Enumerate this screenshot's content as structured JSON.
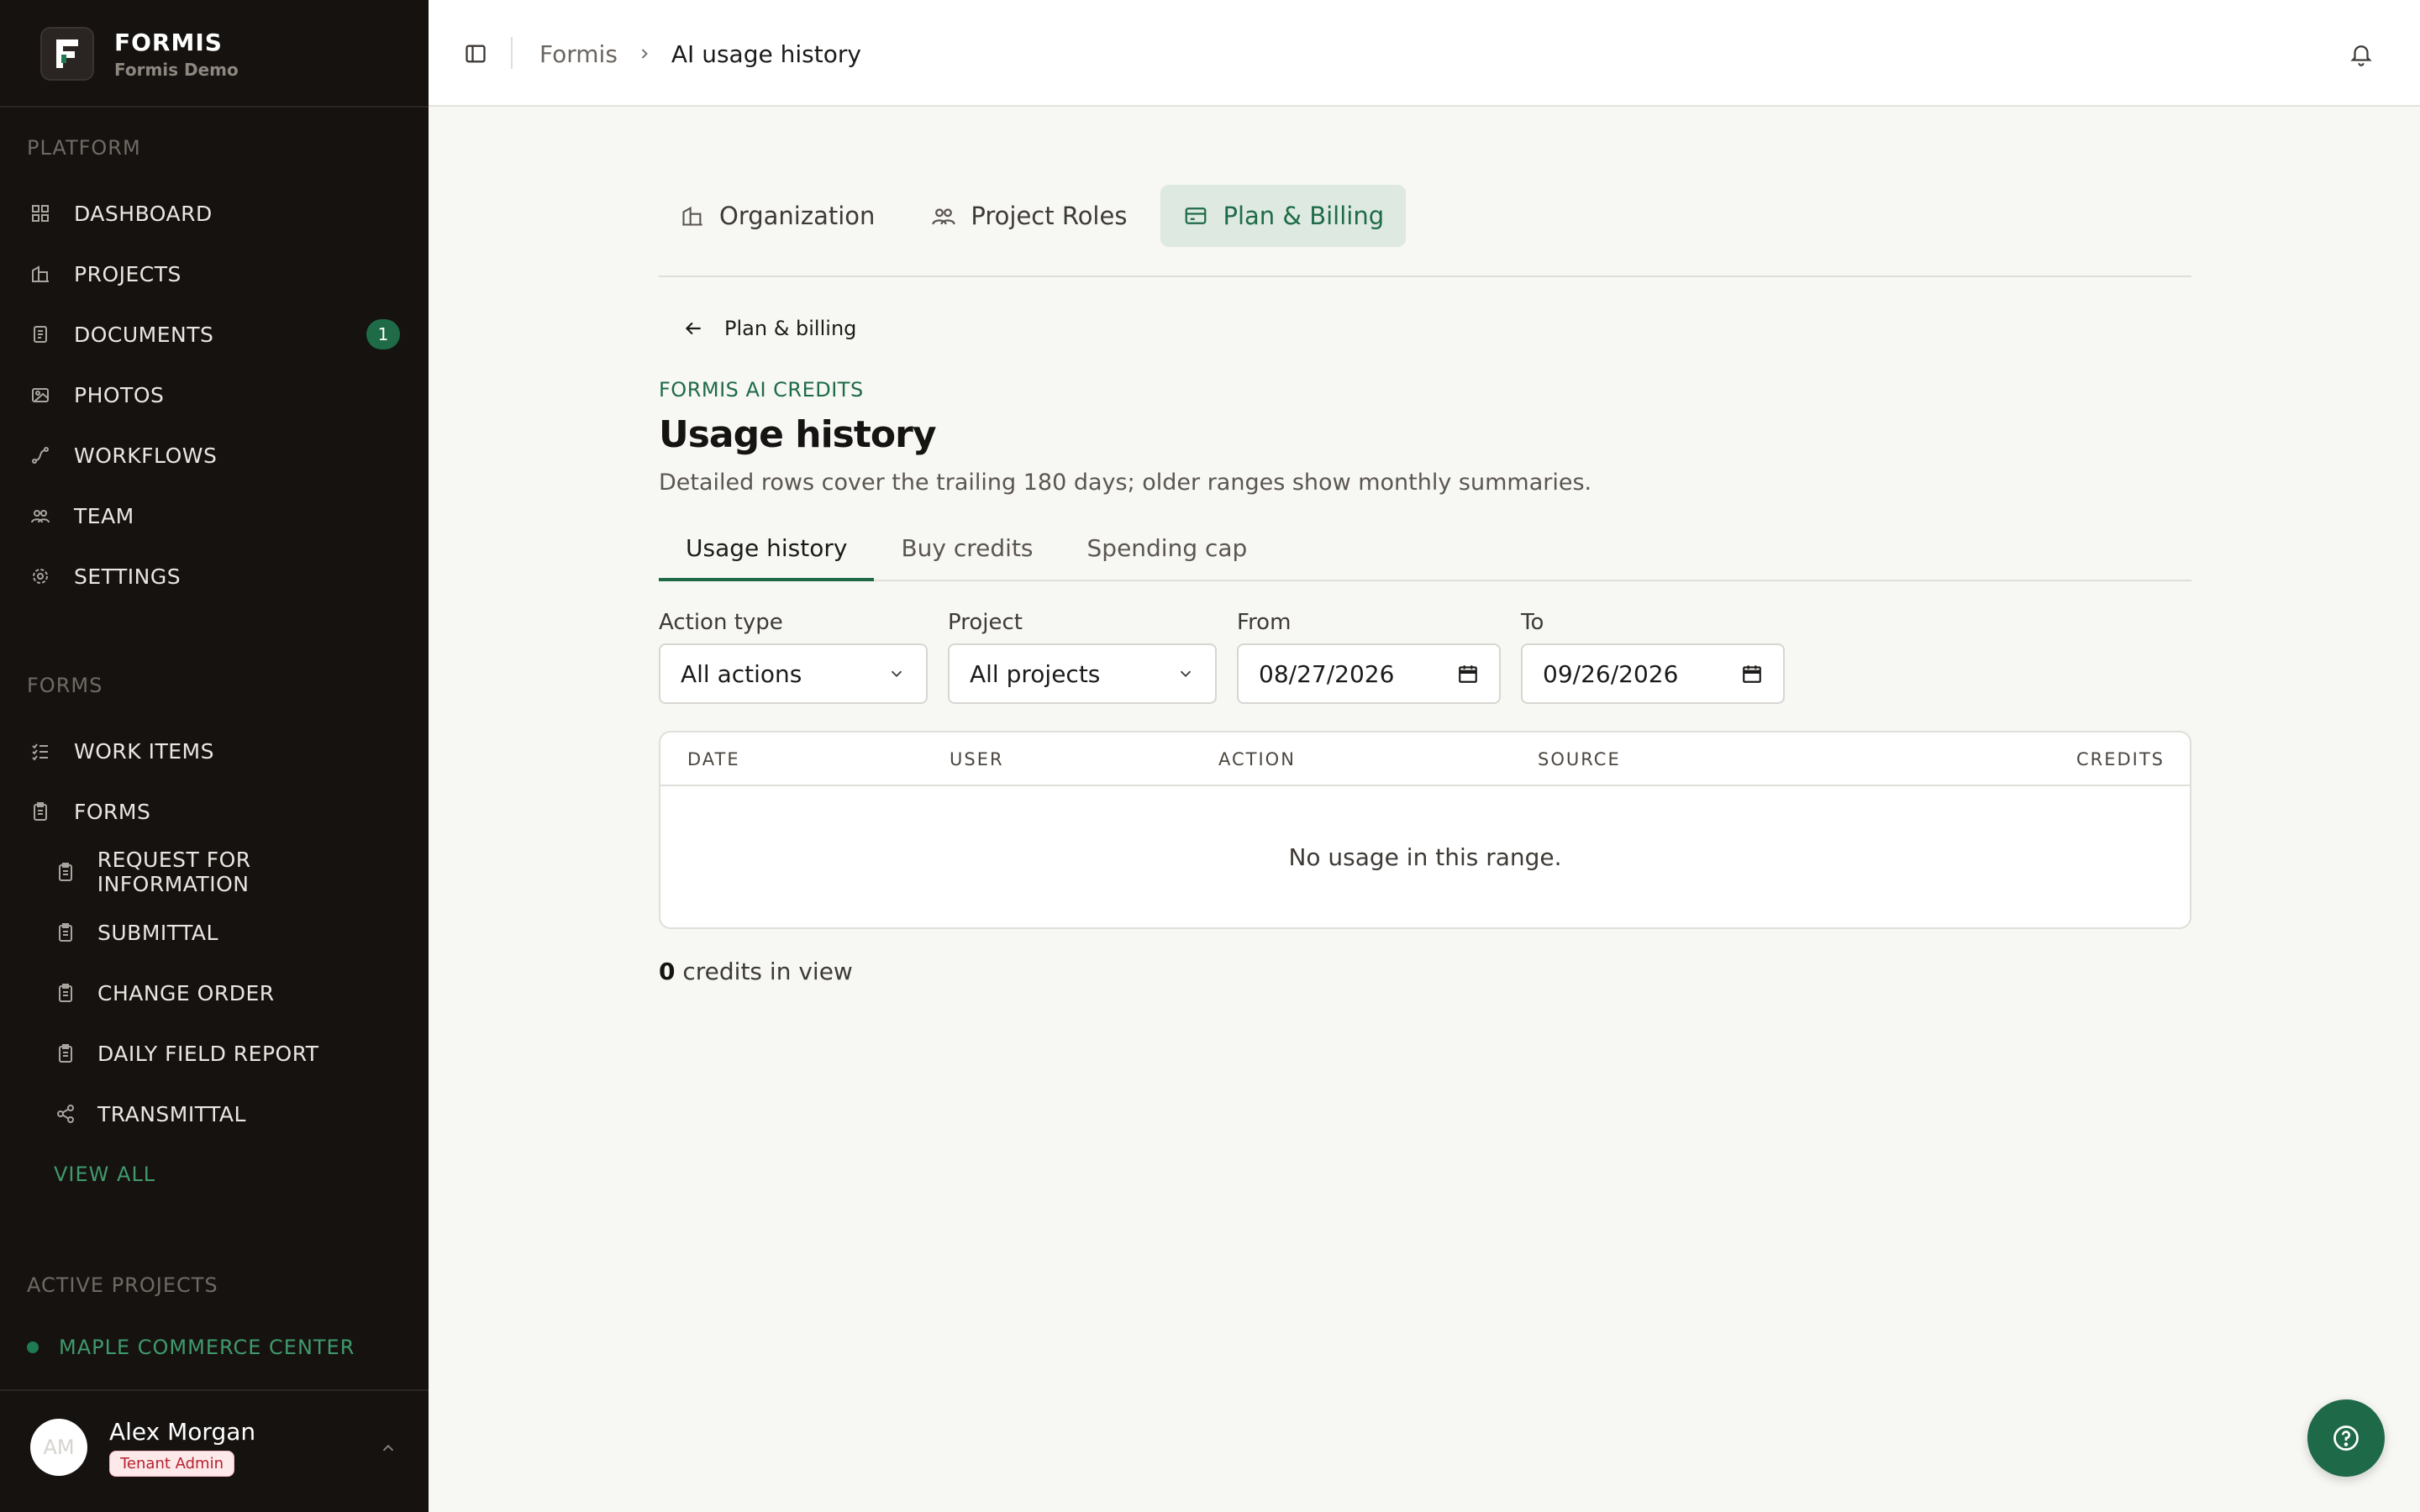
{
  "brand": {
    "name": "FORMIS",
    "workspace": "Formis Demo"
  },
  "sidebar": {
    "platform_label": "PLATFORM",
    "platform_items": [
      {
        "label": "DASHBOARD",
        "icon": "grid-icon"
      },
      {
        "label": "PROJECTS",
        "icon": "building-icon"
      },
      {
        "label": "DOCUMENTS",
        "icon": "document-icon",
        "badge": "1"
      },
      {
        "label": "PHOTOS",
        "icon": "photos-icon"
      },
      {
        "label": "WORKFLOWS",
        "icon": "workflow-icon"
      },
      {
        "label": "TEAM",
        "icon": "team-icon"
      },
      {
        "label": "SETTINGS",
        "icon": "gear-icon"
      }
    ],
    "forms_label": "FORMS",
    "forms_items": [
      {
        "label": "WORK ITEMS",
        "icon": "checklist-icon"
      },
      {
        "label": "FORMS",
        "icon": "clipboard-icon"
      }
    ],
    "forms_sub_items": [
      {
        "label": "REQUEST FOR INFORMATION",
        "icon": "clipboard-icon"
      },
      {
        "label": "SUBMITTAL",
        "icon": "clipboard-icon"
      },
      {
        "label": "CHANGE ORDER",
        "icon": "clipboard-icon"
      },
      {
        "label": "DAILY FIELD REPORT",
        "icon": "clipboard-icon"
      },
      {
        "label": "TRANSMITTAL",
        "icon": "share-icon"
      }
    ],
    "view_all": "VIEW ALL",
    "active_projects_label": "ACTIVE PROJECTS",
    "active_projects": [
      {
        "label": "MAPLE COMMERCE CENTER"
      }
    ],
    "user": {
      "initials": "AM",
      "name": "Alex Morgan",
      "role": "Tenant Admin"
    }
  },
  "topbar": {
    "breadcrumb_root": "Formis",
    "breadcrumb_current": "AI usage history"
  },
  "top_tabs": [
    {
      "label": "Organization",
      "icon": "building-icon"
    },
    {
      "label": "Project Roles",
      "icon": "users-icon"
    },
    {
      "label": "Plan & Billing",
      "icon": "credit-card-icon",
      "active": true
    }
  ],
  "main": {
    "back_label": "Plan & billing",
    "eyebrow": "FORMIS AI CREDITS",
    "title": "Usage history",
    "description": "Detailed rows cover the trailing 180 days; older ranges show monthly summaries."
  },
  "sub_tabs": [
    {
      "label": "Usage history",
      "active": true
    },
    {
      "label": "Buy credits"
    },
    {
      "label": "Spending cap"
    }
  ],
  "filters": {
    "action_type": {
      "label": "Action type",
      "value": "All actions"
    },
    "project": {
      "label": "Project",
      "value": "All projects"
    },
    "from": {
      "label": "From",
      "value": "08/27/2026"
    },
    "to": {
      "label": "To",
      "value": "09/26/2026"
    }
  },
  "table": {
    "columns": [
      "DATE",
      "USER",
      "ACTION",
      "SOURCE",
      "CREDITS"
    ],
    "empty_message": "No usage in this range."
  },
  "summary": {
    "count": "0",
    "text": " credits in view"
  },
  "colors": {
    "sidebar_bg": "#161210",
    "accent": "#1f6b47",
    "page_bg": "#f7f7f4"
  }
}
